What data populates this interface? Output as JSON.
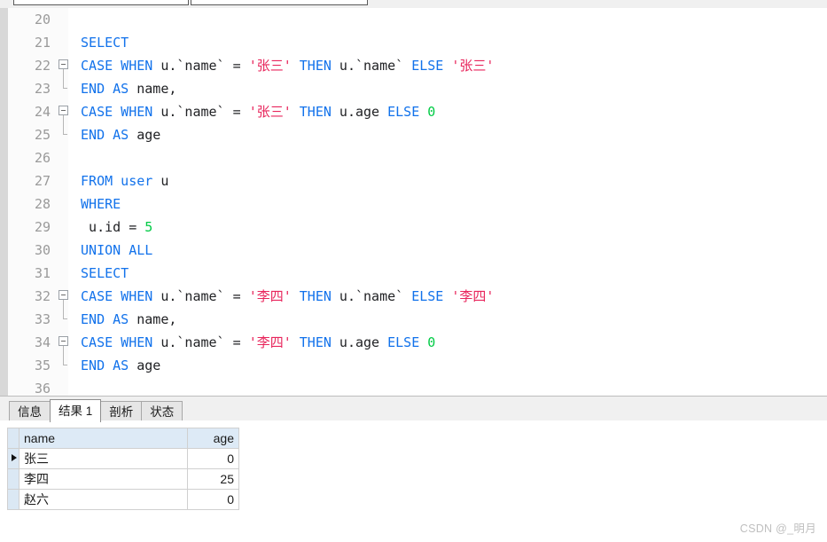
{
  "top_bar": {
    "input_left": {
      "value": "",
      "placeholder": ""
    },
    "input_right": {
      "value": "",
      "placeholder": ""
    }
  },
  "editor": {
    "colors": {
      "keyword": "#1272eb",
      "string": "#e8265c",
      "number": "#00cb45",
      "identifier": "#202124",
      "line_number": "#9a9a9a",
      "gutter_bg": "#fbfbfb",
      "background": "#ffffff"
    },
    "first_visible_line": 20,
    "lines": [
      {
        "no": "20",
        "fold": "none",
        "tokens": []
      },
      {
        "no": "21",
        "fold": "none",
        "tokens": [
          {
            "t": "id",
            "s": " "
          },
          {
            "t": "kw",
            "s": "SELECT"
          }
        ]
      },
      {
        "no": "22",
        "fold": "start",
        "tokens": [
          {
            "t": "id",
            "s": " "
          },
          {
            "t": "kw",
            "s": "CASE WHEN"
          },
          {
            "t": "id",
            "s": " u.`name` = "
          },
          {
            "t": "str",
            "s": "'张三'"
          },
          {
            "t": "id",
            "s": " "
          },
          {
            "t": "kw",
            "s": "THEN"
          },
          {
            "t": "id",
            "s": " u.`name` "
          },
          {
            "t": "kw",
            "s": "ELSE"
          },
          {
            "t": "id",
            "s": " "
          },
          {
            "t": "str",
            "s": "'张三'"
          }
        ]
      },
      {
        "no": "23",
        "fold": "end",
        "tokens": [
          {
            "t": "id",
            "s": " "
          },
          {
            "t": "kw",
            "s": "END AS"
          },
          {
            "t": "id",
            "s": " name,"
          }
        ]
      },
      {
        "no": "24",
        "fold": "start",
        "tokens": [
          {
            "t": "id",
            "s": " "
          },
          {
            "t": "kw",
            "s": "CASE WHEN"
          },
          {
            "t": "id",
            "s": " u.`name` = "
          },
          {
            "t": "str",
            "s": "'张三'"
          },
          {
            "t": "id",
            "s": " "
          },
          {
            "t": "kw",
            "s": "THEN"
          },
          {
            "t": "id",
            "s": " u.age "
          },
          {
            "t": "kw",
            "s": "ELSE"
          },
          {
            "t": "id",
            "s": " "
          },
          {
            "t": "num",
            "s": "0"
          }
        ]
      },
      {
        "no": "25",
        "fold": "end",
        "tokens": [
          {
            "t": "id",
            "s": " "
          },
          {
            "t": "kw",
            "s": "END AS"
          },
          {
            "t": "id",
            "s": " age"
          }
        ]
      },
      {
        "no": "26",
        "fold": "none",
        "tokens": []
      },
      {
        "no": "27",
        "fold": "none",
        "tokens": [
          {
            "t": "id",
            "s": " "
          },
          {
            "t": "kw",
            "s": "FROM user"
          },
          {
            "t": "id",
            "s": " u"
          }
        ]
      },
      {
        "no": "28",
        "fold": "none",
        "tokens": [
          {
            "t": "id",
            "s": " "
          },
          {
            "t": "kw",
            "s": "WHERE"
          }
        ]
      },
      {
        "no": "29",
        "fold": "none",
        "tokens": [
          {
            "t": "id",
            "s": "  u.id = "
          },
          {
            "t": "num",
            "s": "5"
          }
        ]
      },
      {
        "no": "30",
        "fold": "none",
        "tokens": [
          {
            "t": "id",
            "s": " "
          },
          {
            "t": "kw",
            "s": "UNION ALL"
          }
        ]
      },
      {
        "no": "31",
        "fold": "none",
        "tokens": [
          {
            "t": "id",
            "s": " "
          },
          {
            "t": "kw",
            "s": "SELECT"
          }
        ]
      },
      {
        "no": "32",
        "fold": "start",
        "tokens": [
          {
            "t": "id",
            "s": " "
          },
          {
            "t": "kw",
            "s": "CASE WHEN"
          },
          {
            "t": "id",
            "s": " u.`name` = "
          },
          {
            "t": "str",
            "s": "'李四'"
          },
          {
            "t": "id",
            "s": " "
          },
          {
            "t": "kw",
            "s": "THEN"
          },
          {
            "t": "id",
            "s": " u.`name` "
          },
          {
            "t": "kw",
            "s": "ELSE"
          },
          {
            "t": "id",
            "s": " "
          },
          {
            "t": "str",
            "s": "'李四'"
          }
        ]
      },
      {
        "no": "33",
        "fold": "end",
        "tokens": [
          {
            "t": "id",
            "s": " "
          },
          {
            "t": "kw",
            "s": "END AS"
          },
          {
            "t": "id",
            "s": " name,"
          }
        ]
      },
      {
        "no": "34",
        "fold": "start",
        "tokens": [
          {
            "t": "id",
            "s": " "
          },
          {
            "t": "kw",
            "s": "CASE WHEN"
          },
          {
            "t": "id",
            "s": " u.`name` = "
          },
          {
            "t": "str",
            "s": "'李四'"
          },
          {
            "t": "id",
            "s": " "
          },
          {
            "t": "kw",
            "s": "THEN"
          },
          {
            "t": "id",
            "s": " u.age "
          },
          {
            "t": "kw",
            "s": "ELSE"
          },
          {
            "t": "id",
            "s": " "
          },
          {
            "t": "num",
            "s": "0"
          }
        ]
      },
      {
        "no": "35",
        "fold": "end",
        "tokens": [
          {
            "t": "id",
            "s": " "
          },
          {
            "t": "kw",
            "s": "END AS"
          },
          {
            "t": "id",
            "s": " age"
          }
        ]
      },
      {
        "no": "36",
        "fold": "none",
        "tokens": []
      }
    ]
  },
  "result_tabs": {
    "items": [
      {
        "label": "信息",
        "active": false
      },
      {
        "label": "结果 1",
        "active": true
      },
      {
        "label": "剖析",
        "active": false
      },
      {
        "label": "状态",
        "active": false
      }
    ]
  },
  "result_grid": {
    "columns": [
      "name",
      "age"
    ],
    "rows": [
      {
        "name": "张三",
        "age": "0",
        "current": true
      },
      {
        "name": "李四",
        "age": "25",
        "current": false
      },
      {
        "name": "赵六",
        "age": "0",
        "current": false
      }
    ]
  },
  "watermark": {
    "text": "CSDN @_明月"
  }
}
